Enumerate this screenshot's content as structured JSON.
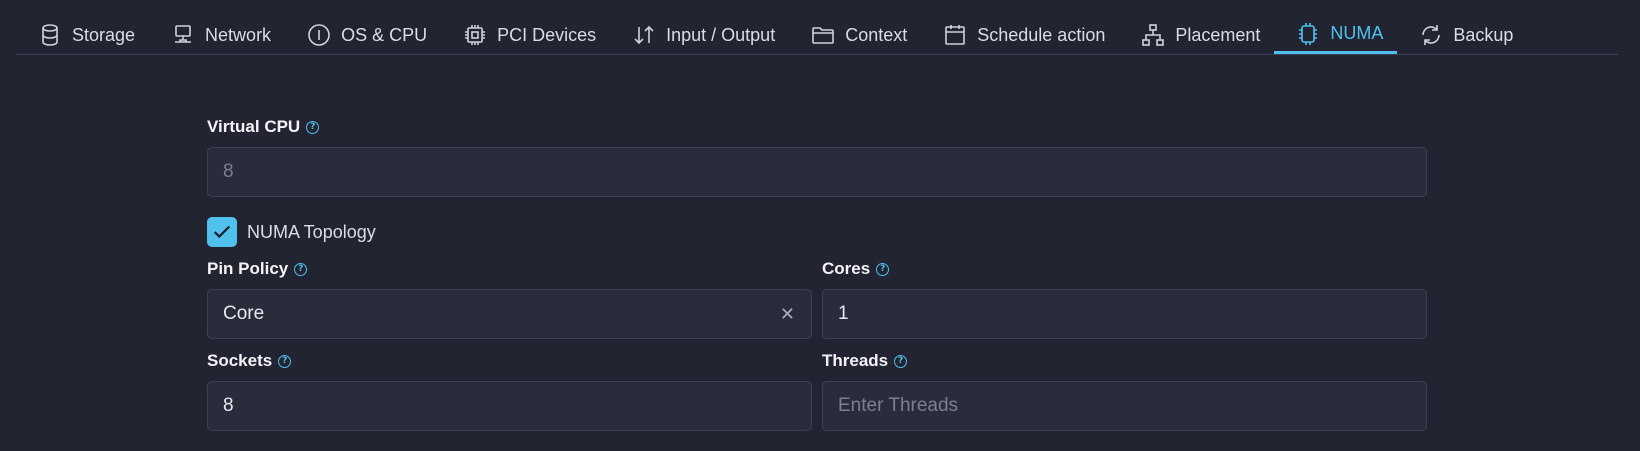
{
  "tabs": [
    {
      "label": "Storage",
      "icon": "database-icon"
    },
    {
      "label": "Network",
      "icon": "network-icon"
    },
    {
      "label": "OS & CPU",
      "icon": "info-circle-icon"
    },
    {
      "label": "PCI Devices",
      "icon": "chip-icon"
    },
    {
      "label": "Input / Output",
      "icon": "arrows-updown-icon"
    },
    {
      "label": "Context",
      "icon": "folder-icon"
    },
    {
      "label": "Schedule action",
      "icon": "calendar-icon"
    },
    {
      "label": "Placement",
      "icon": "hierarchy-icon"
    },
    {
      "label": "NUMA",
      "icon": "cpu-icon",
      "active": true
    },
    {
      "label": "Backup",
      "icon": "refresh-icon"
    }
  ],
  "form": {
    "vcpu": {
      "label": "Virtual CPU",
      "value": "8"
    },
    "numa_topology": {
      "label": "NUMA Topology",
      "checked": true
    },
    "pin_policy": {
      "label": "Pin Policy",
      "value": "Core"
    },
    "cores": {
      "label": "Cores",
      "value": "1"
    },
    "sockets": {
      "label": "Sockets",
      "value": "8"
    },
    "threads": {
      "label": "Threads",
      "placeholder": "Enter Threads"
    }
  },
  "colors": {
    "accent": "#4fc1ec",
    "background": "#222431",
    "field": "#2a2c3c"
  }
}
